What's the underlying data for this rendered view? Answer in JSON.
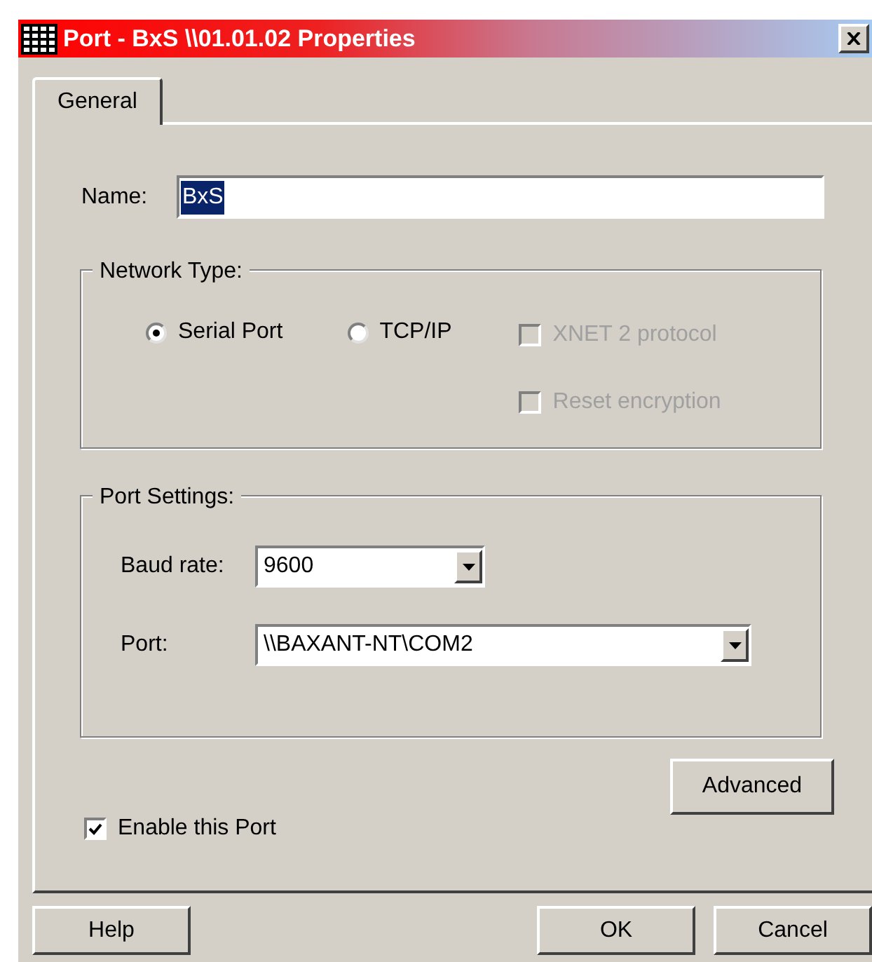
{
  "window": {
    "title": "Port - BxS \\\\01.01.02 Properties"
  },
  "tabs": [
    {
      "label": "General",
      "selected": true
    }
  ],
  "name_field": {
    "label": "Name:",
    "value": "BxS"
  },
  "network_type": {
    "legend": "Network Type:",
    "options": [
      {
        "kind": "radio",
        "label": "Serial Port",
        "selected": true,
        "disabled": false
      },
      {
        "kind": "radio",
        "label": "TCP/IP",
        "selected": false,
        "disabled": false
      },
      {
        "kind": "checkbox",
        "label": "XNET 2 protocol",
        "checked": false,
        "disabled": true
      },
      {
        "kind": "checkbox",
        "label": "Reset encryption",
        "checked": false,
        "disabled": true
      }
    ]
  },
  "port_settings": {
    "legend": "Port Settings:",
    "baud_rate": {
      "label": "Baud rate:",
      "value": "9600"
    },
    "port": {
      "label": "Port:",
      "value": "\\\\BAXANT-NT\\COM2"
    }
  },
  "advanced_button": "Advanced",
  "enable_port": {
    "label": "Enable this Port",
    "checked": true
  },
  "buttons": [
    {
      "label": "Help"
    },
    {
      "label": "OK"
    },
    {
      "label": "Cancel"
    }
  ]
}
